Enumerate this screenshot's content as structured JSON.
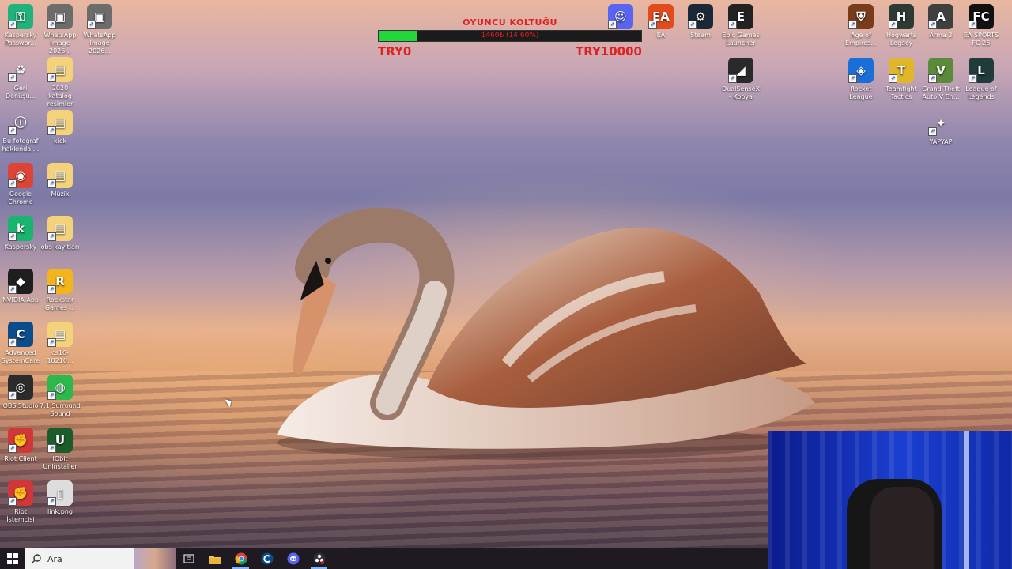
{
  "goal_widget": {
    "title": "OYUNCU KOLTUĞU",
    "progress_text": "1460₺ (14.60%)",
    "progress_fraction": 0.146,
    "min_label": "TRY0",
    "max_label": "TRY10000",
    "text_color": "#e12020",
    "fill_color": "#22d63b"
  },
  "left_icons": [
    {
      "label": "Kaspersky Passwor...",
      "icon": "kaspersky-password-icon"
    },
    {
      "label": "WhatsApp Image 2026...",
      "icon": "image-file-icon"
    },
    {
      "label": "WhatsApp Image 2026...",
      "icon": "image-file-icon"
    },
    {
      "label": "Geri Dönüşü...",
      "icon": "recycle-bin-icon"
    },
    {
      "label": "2020 katalog resimler",
      "icon": "folder-icon"
    },
    {
      "label": "Bu fotoğraf hakkında ...",
      "icon": "info-icon"
    },
    {
      "label": "kick",
      "icon": "folder-icon"
    },
    {
      "label": "Google Chrome",
      "icon": "chrome-icon"
    },
    {
      "label": "Müzik",
      "icon": "folder-icon"
    },
    {
      "label": "Kaspersky",
      "icon": "kaspersky-icon"
    },
    {
      "label": "obs kayıtları",
      "icon": "folder-icon"
    },
    {
      "label": "NVIDIA App",
      "icon": "nvidia-icon"
    },
    {
      "label": "Rockstar Games ...",
      "icon": "rockstar-icon"
    },
    {
      "label": "Advanced SystemCare",
      "icon": "systemcare-icon"
    },
    {
      "label": "cs16-10210...",
      "icon": "folder-icon"
    },
    {
      "label": "OBS Studio",
      "icon": "obs-icon"
    },
    {
      "label": "7.1 Surround Sound",
      "icon": "surround-icon"
    },
    {
      "label": "Riot Client",
      "icon": "riot-icon"
    },
    {
      "label": "IObit Uninstaller",
      "icon": "iobit-icon"
    },
    {
      "label": "Riot İstemcisi",
      "icon": "riot-icon"
    },
    {
      "label": "link.png",
      "icon": "png-file-icon"
    }
  ],
  "top_icons": [
    {
      "label": "",
      "icon": "discord-icon"
    },
    {
      "label": "EA",
      "icon": "ea-icon"
    },
    {
      "label": "Steam",
      "icon": "steam-icon"
    },
    {
      "label": "Epic Games Launcher",
      "icon": "epic-games-icon"
    },
    {
      "label": "DualSenseX - Kopya",
      "icon": "dualsensex-icon"
    }
  ],
  "right_icons": [
    {
      "label": "Age of Empires...",
      "icon": "age-of-empires-icon"
    },
    {
      "label": "Hogwarts Legacy",
      "icon": "hogwarts-icon"
    },
    {
      "label": "Arma 3",
      "icon": "arma-icon"
    },
    {
      "label": "EA SPORTS FC 26",
      "icon": "fc26-icon"
    },
    {
      "label": "Rocket League",
      "icon": "rocket-league-icon"
    },
    {
      "label": "Teamfight Tactics",
      "icon": "tft-icon"
    },
    {
      "label": "Grand Theft Auto V En...",
      "icon": "gta-icon"
    },
    {
      "label": "League of Legends",
      "icon": "lol-icon"
    },
    {
      "label": "YAPYAP",
      "icon": "yapyap-icon"
    }
  ],
  "taskbar": {
    "search_placeholder": "Ara",
    "items": [
      "task-view-icon",
      "file-explorer-icon",
      "chrome-icon",
      "systemcare-icon",
      "discord-icon",
      "obs-icon"
    ]
  }
}
